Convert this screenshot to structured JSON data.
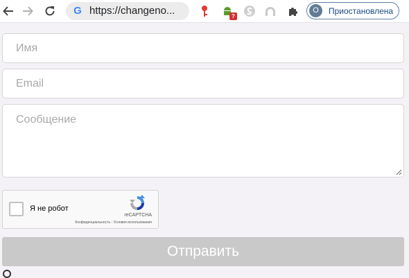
{
  "browser": {
    "url": "https://changeno...",
    "profile_initial": "О",
    "profile_status": "Приостановлена",
    "extension_badge": "?"
  },
  "form": {
    "name_placeholder": "Имя",
    "email_placeholder": "Email",
    "message_placeholder": "Сообщение",
    "submit_label": "Отправить"
  },
  "recaptcha": {
    "label": "Я не робот",
    "brand": "reCAPTCHA",
    "terms": "Конфиденциальность - Условия использования"
  }
}
